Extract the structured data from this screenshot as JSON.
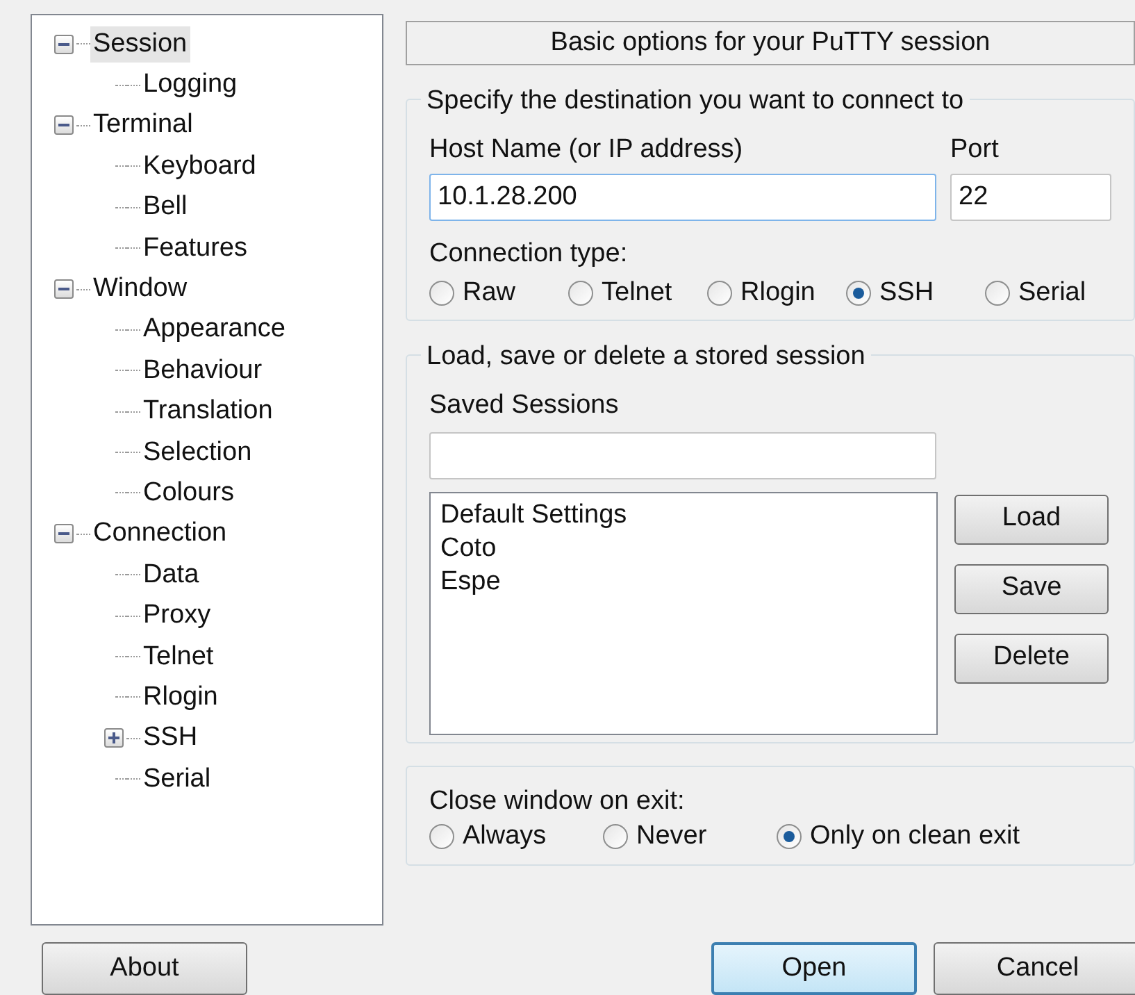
{
  "tree": [
    {
      "label": "Session",
      "selected": true,
      "expanded": true,
      "children": [
        {
          "label": "Logging",
          "selected": false
        }
      ]
    },
    {
      "label": "Terminal",
      "selected": false,
      "expanded": true,
      "children": [
        {
          "label": "Keyboard",
          "selected": false
        },
        {
          "label": "Bell",
          "selected": false
        },
        {
          "label": "Features",
          "selected": false
        }
      ]
    },
    {
      "label": "Window",
      "selected": false,
      "expanded": true,
      "children": [
        {
          "label": "Appearance",
          "selected": false
        },
        {
          "label": "Behaviour",
          "selected": false
        },
        {
          "label": "Translation",
          "selected": false
        },
        {
          "label": "Selection",
          "selected": false
        },
        {
          "label": "Colours",
          "selected": false
        }
      ]
    },
    {
      "label": "Connection",
      "selected": false,
      "expanded": true,
      "children": [
        {
          "label": "Data",
          "selected": false
        },
        {
          "label": "Proxy",
          "selected": false
        },
        {
          "label": "Telnet",
          "selected": false
        },
        {
          "label": "Rlogin",
          "selected": false
        },
        {
          "label": "SSH",
          "selected": false,
          "expanded": false
        },
        {
          "label": "Serial",
          "selected": false
        }
      ]
    }
  ],
  "header": "Basic options for your PuTTY session",
  "destination": {
    "legend": "Specify the destination you want to connect to",
    "host_label": "Host Name (or IP address)",
    "host_value": "10.1.28.200",
    "port_label": "Port",
    "port_value": "22",
    "connection_type_label": "Connection type:",
    "connection_types": [
      {
        "label": "Raw",
        "selected": false
      },
      {
        "label": "Telnet",
        "selected": false
      },
      {
        "label": "Rlogin",
        "selected": false
      },
      {
        "label": "SSH",
        "selected": true
      },
      {
        "label": "Serial",
        "selected": false
      }
    ]
  },
  "stored_sessions": {
    "legend": "Load, save or delete a stored session",
    "saved_sessions_label": "Saved Sessions",
    "sessions": [
      {
        "label": "Default Settings",
        "selected": false
      },
      {
        "label": "Coto",
        "selected": false
      },
      {
        "label": "Espe",
        "selected": false
      }
    ],
    "buttons": [
      "Load",
      "Save",
      "Delete"
    ]
  },
  "close_on_exit": {
    "label": "Close window on exit:",
    "options": [
      {
        "label": "Always",
        "selected": false
      },
      {
        "label": "Never",
        "selected": false
      },
      {
        "label": "Only on clean exit",
        "selected": true
      }
    ]
  },
  "buttons": [
    {
      "label": "About",
      "default": false
    },
    {
      "label": "Open",
      "default": true
    },
    {
      "label": "Cancel",
      "default": false
    }
  ]
}
